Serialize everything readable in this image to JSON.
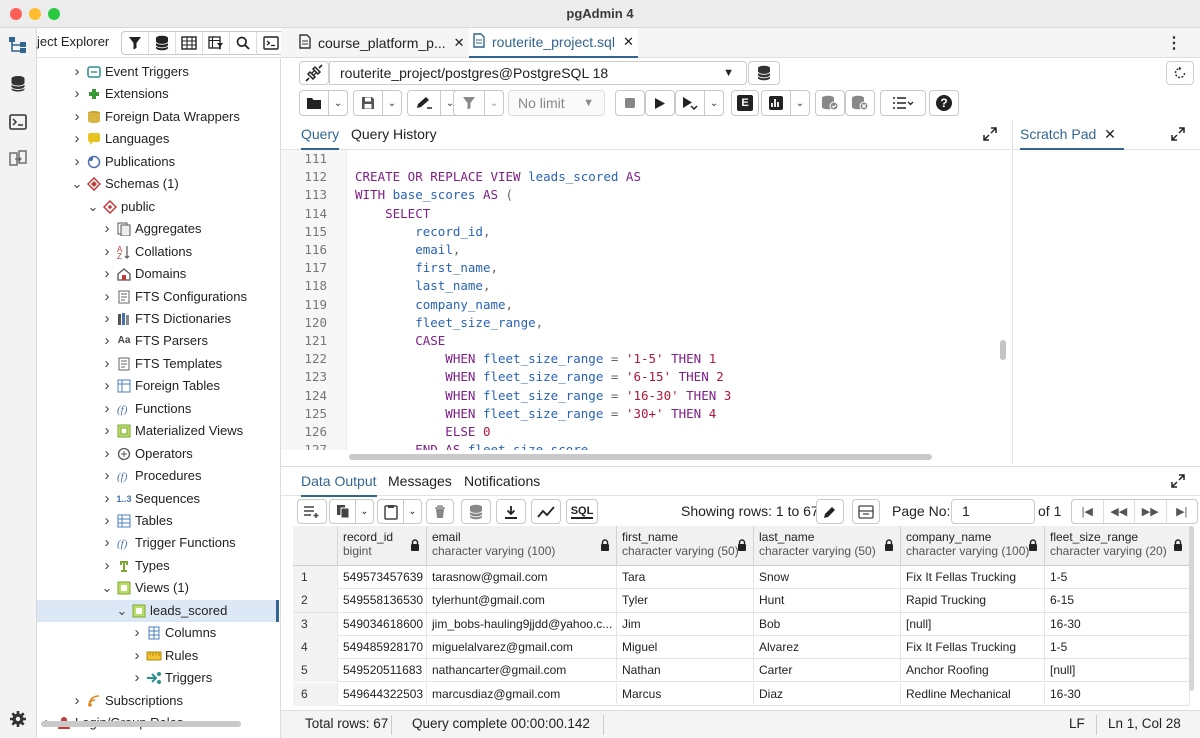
{
  "window": {
    "title": "pgAdmin 4"
  },
  "tree": {
    "title": "ject Explorer",
    "items": [
      {
        "label": "Event Triggers"
      },
      {
        "label": "Extensions"
      },
      {
        "label": "Foreign Data Wrappers"
      },
      {
        "label": "Languages"
      },
      {
        "label": "Publications"
      },
      {
        "label": "Schemas (1)"
      },
      {
        "label": "public"
      },
      {
        "label": "Aggregates"
      },
      {
        "label": "Collations"
      },
      {
        "label": "Domains"
      },
      {
        "label": "FTS Configurations"
      },
      {
        "label": "FTS Dictionaries"
      },
      {
        "label": "FTS Parsers"
      },
      {
        "label": "FTS Templates"
      },
      {
        "label": "Foreign Tables"
      },
      {
        "label": "Functions"
      },
      {
        "label": "Materialized Views"
      },
      {
        "label": "Operators"
      },
      {
        "label": "Procedures"
      },
      {
        "label": "Sequences"
      },
      {
        "label": "Tables"
      },
      {
        "label": "Trigger Functions"
      },
      {
        "label": "Types"
      },
      {
        "label": "Views (1)"
      },
      {
        "label": "leads_scored"
      },
      {
        "label": "Columns"
      },
      {
        "label": "Rules"
      },
      {
        "label": "Triggers"
      },
      {
        "label": "Subscriptions"
      },
      {
        "label": "Login/Group Roles"
      }
    ],
    "fts_parsers_icon_text": "Aa",
    "sequences_icon_text": "1..3"
  },
  "tabs": [
    {
      "label": "course_platform_p..."
    },
    {
      "label": "routerite_project.sql"
    }
  ],
  "connection": {
    "label": "routerite_project/postgres@PostgreSQL 18"
  },
  "toolbar": {
    "limit": "No limit",
    "explain_label": "E"
  },
  "query_tabs": {
    "query": "Query",
    "history": "Query History"
  },
  "scratch": {
    "label": "Scratch Pad"
  },
  "editor": {
    "line_numbers": [
      "111",
      "112",
      "113",
      "114",
      "115",
      "116",
      "117",
      "118",
      "119",
      "120",
      "121",
      "122",
      "123",
      "124",
      "125",
      "126",
      "127"
    ],
    "lines": [
      [],
      [
        {
          "t": "CREATE OR REPLACE VIEW ",
          "c": "kw"
        },
        {
          "t": "leads_scored",
          "c": "id"
        },
        {
          "t": " AS",
          "c": "kw"
        }
      ],
      [
        {
          "t": "WITH ",
          "c": "kw"
        },
        {
          "t": "base_scores",
          "c": "id"
        },
        {
          "t": " AS",
          "c": "kw"
        },
        {
          "t": " (",
          "c": "pn"
        }
      ],
      [
        {
          "t": "    SELECT",
          "c": "kw"
        }
      ],
      [
        {
          "t": "        "
        },
        {
          "t": "record_id",
          "c": "id"
        },
        {
          "t": ",",
          "c": "pn"
        }
      ],
      [
        {
          "t": "        "
        },
        {
          "t": "email",
          "c": "id"
        },
        {
          "t": ",",
          "c": "pn"
        }
      ],
      [
        {
          "t": "        "
        },
        {
          "t": "first_name",
          "c": "id"
        },
        {
          "t": ",",
          "c": "pn"
        }
      ],
      [
        {
          "t": "        "
        },
        {
          "t": "last_name",
          "c": "id"
        },
        {
          "t": ",",
          "c": "pn"
        }
      ],
      [
        {
          "t": "        "
        },
        {
          "t": "company_name",
          "c": "id"
        },
        {
          "t": ",",
          "c": "pn"
        }
      ],
      [
        {
          "t": "        "
        },
        {
          "t": "fleet_size_range",
          "c": "id"
        },
        {
          "t": ",",
          "c": "pn"
        }
      ],
      [
        {
          "t": "        CASE",
          "c": "kw"
        }
      ],
      [
        {
          "t": "            WHEN ",
          "c": "kw"
        },
        {
          "t": "fleet_size_range",
          "c": "id"
        },
        {
          "t": " = ",
          "c": "pn"
        },
        {
          "t": "'1-5'",
          "c": "str"
        },
        {
          "t": " THEN ",
          "c": "kw"
        },
        {
          "t": "1",
          "c": "num"
        }
      ],
      [
        {
          "t": "            WHEN ",
          "c": "kw"
        },
        {
          "t": "fleet_size_range",
          "c": "id"
        },
        {
          "t": " = ",
          "c": "pn"
        },
        {
          "t": "'6-15'",
          "c": "str"
        },
        {
          "t": " THEN ",
          "c": "kw"
        },
        {
          "t": "2",
          "c": "num"
        }
      ],
      [
        {
          "t": "            WHEN ",
          "c": "kw"
        },
        {
          "t": "fleet_size_range",
          "c": "id"
        },
        {
          "t": " = ",
          "c": "pn"
        },
        {
          "t": "'16-30'",
          "c": "str"
        },
        {
          "t": " THEN ",
          "c": "kw"
        },
        {
          "t": "3",
          "c": "num"
        }
      ],
      [
        {
          "t": "            WHEN ",
          "c": "kw"
        },
        {
          "t": "fleet_size_range",
          "c": "id"
        },
        {
          "t": " = ",
          "c": "pn"
        },
        {
          "t": "'30+'",
          "c": "str"
        },
        {
          "t": " THEN ",
          "c": "kw"
        },
        {
          "t": "4",
          "c": "num"
        }
      ],
      [
        {
          "t": "            ELSE ",
          "c": "kw"
        },
        {
          "t": "0",
          "c": "num"
        }
      ],
      [
        {
          "t": "        END AS ",
          "c": "kw"
        },
        {
          "t": "fleet_size_score",
          "c": "id"
        }
      ]
    ]
  },
  "results": {
    "tabs": [
      "Data Output",
      "Messages",
      "Notifications"
    ],
    "showing": "Showing rows: 1 to 67",
    "page_label": "Page No:",
    "page_value": "1",
    "of_label": "of 1",
    "sql_label": "SQL",
    "columns": [
      {
        "name": "record_id",
        "type": "bigint"
      },
      {
        "name": "email",
        "type": "character varying (100)"
      },
      {
        "name": "first_name",
        "type": "character varying (50)"
      },
      {
        "name": "last_name",
        "type": "character varying (50)"
      },
      {
        "name": "company_name",
        "type": "character varying (100)"
      },
      {
        "name": "fleet_size_range",
        "type": "character varying (20)"
      }
    ],
    "rows": [
      [
        "1",
        "549573457639",
        "tarasnow@gmail.com",
        "Tara",
        "Snow",
        "Fix It Fellas Trucking",
        "1-5"
      ],
      [
        "2",
        "549558136530",
        "tylerhunt@gmail.com",
        "Tyler",
        "Hunt",
        "Rapid Trucking",
        "6-15"
      ],
      [
        "3",
        "549034618600",
        "jim_bobs-hauling9jjdd@yahoo.c...",
        "Jim",
        "Bob",
        "[null]",
        "16-30"
      ],
      [
        "4",
        "549485928170",
        "miguelalvarez@gmail.com",
        "Miguel",
        "Alvarez",
        "Fix It Fellas Trucking",
        "1-5"
      ],
      [
        "5",
        "549520511683",
        "nathancarter@gmail.com",
        "Nathan",
        "Carter",
        "Anchor Roofing",
        "[null]"
      ],
      [
        "6",
        "549644322503",
        "marcusdiaz@gmail.com",
        "Marcus",
        "Diaz",
        "Redline Mechanical",
        "16-30"
      ]
    ]
  },
  "status": {
    "total": "Total rows: 67",
    "query": "Query complete 00:00:00.142",
    "eol": "LF",
    "position": "Ln 1, Col 28"
  }
}
